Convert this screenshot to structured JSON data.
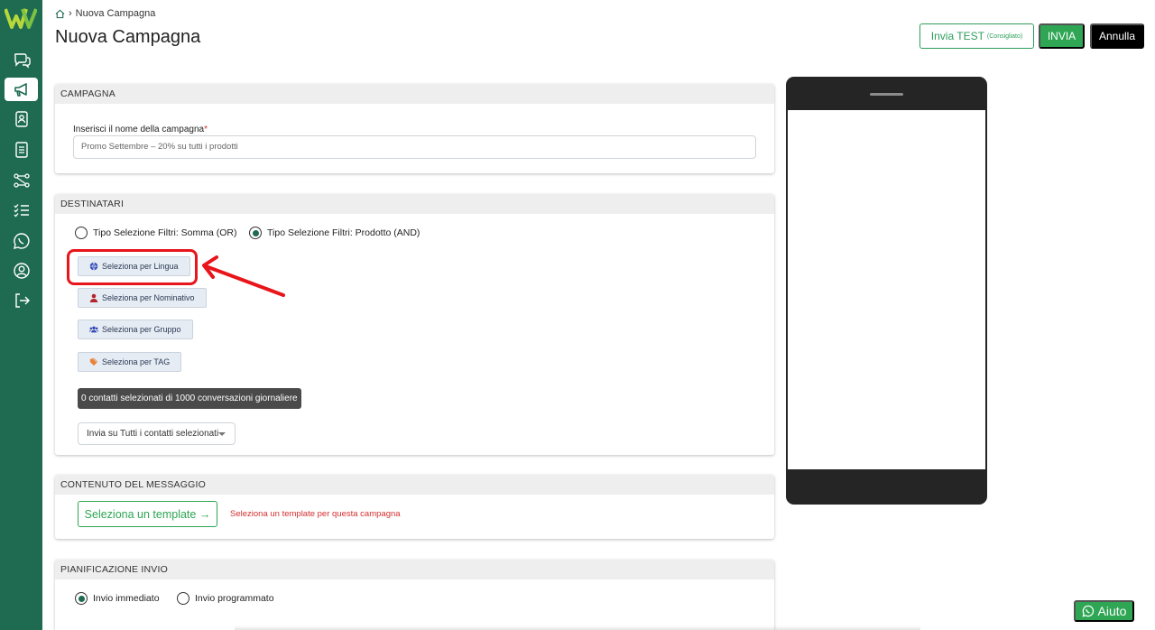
{
  "breadcrumb": {
    "home_icon": "home-icon",
    "separator": "›",
    "current": "Nuova Campagna"
  },
  "header": {
    "title": "Nuova Campagna",
    "test_label": "Invia TEST",
    "test_hint": "(Consigliato)",
    "send_label": "INVIA",
    "cancel_label": "Annulla"
  },
  "sidebar": {
    "items": [
      {
        "icon": "chat-icon"
      },
      {
        "icon": "megaphone-icon",
        "active": true
      },
      {
        "icon": "contacts-icon"
      },
      {
        "icon": "document-icon"
      },
      {
        "icon": "flow-icon"
      },
      {
        "icon": "checklist-icon"
      },
      {
        "icon": "whatsapp-icon"
      },
      {
        "icon": "user-circle-icon"
      },
      {
        "icon": "logout-icon"
      }
    ]
  },
  "campaign": {
    "header": "CAMPAGNA",
    "name_label": "Inserisci il nome della campagna",
    "required_mark": "*",
    "name_placeholder": "Promo Settembre – 20% su tutti i prodotti"
  },
  "recipients": {
    "header": "DESTINATARI",
    "filter_or": "Tipo Selezione Filtri: Somma (OR)",
    "filter_and": "Tipo Selezione Filtri: Prodotto (AND)",
    "selected_filter": "AND",
    "btn_language": "Seleziona per Lingua",
    "btn_name": "Seleziona per Nominativo",
    "btn_group": "Seleziona per Gruppo",
    "btn_tag": "Seleziona per TAG",
    "counter": "0 contatti selezionati di 1000 conversazioni giornaliere",
    "send_to_select": "Invia su Tutti i contatti selezionati"
  },
  "content": {
    "header": "CONTENUTO DEL MESSAGGIO",
    "template_btn": "Seleziona un template →",
    "template_hint": "Seleziona un template per questa campagna"
  },
  "schedule": {
    "header": "PIANIFICAZIONE INVIO",
    "immediate": "Invio immediato",
    "scheduled": "Invio programmato",
    "selected": "immediate"
  },
  "help": {
    "label": "Aiuto",
    "icon": "whatsapp-icon"
  },
  "colors": {
    "sidebar": "#1e6b52",
    "accent_green": "#2ea654",
    "error_red": "#d32f2f",
    "annotation_red": "#e8151b"
  }
}
